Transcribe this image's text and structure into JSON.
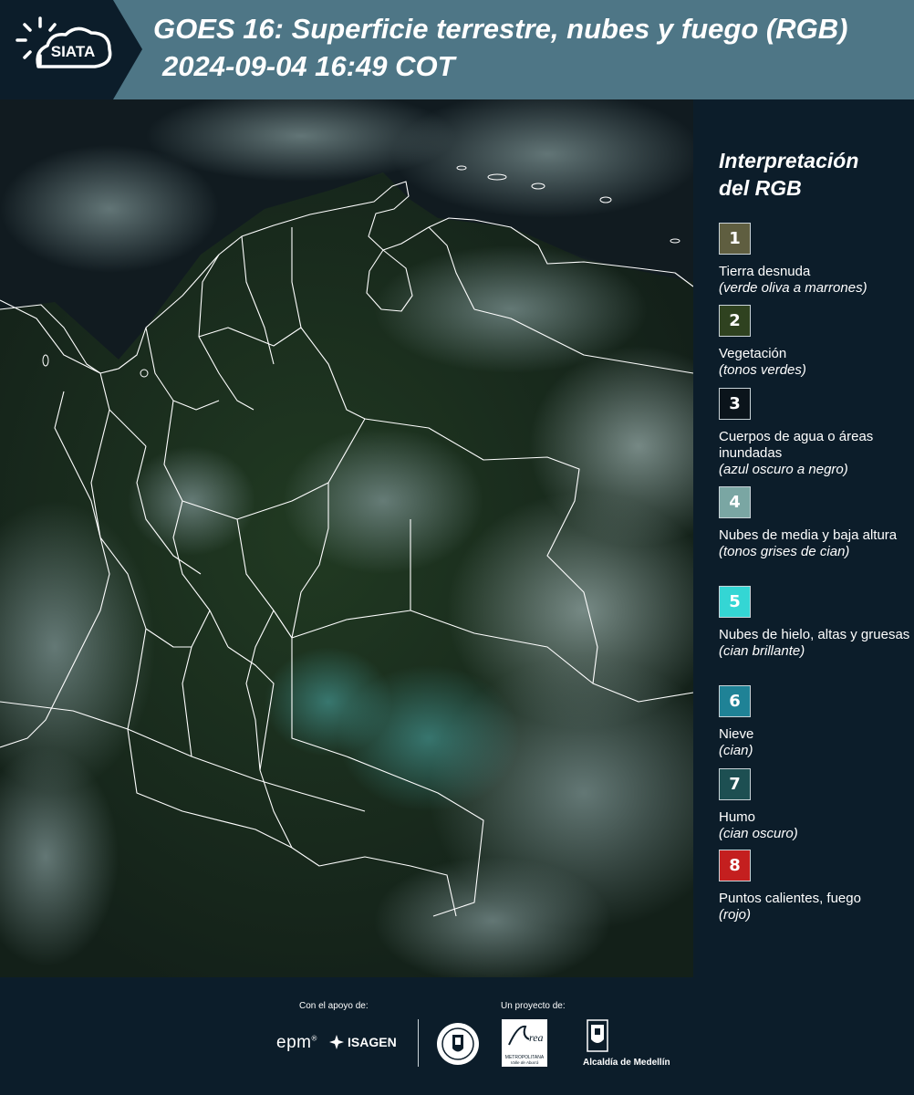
{
  "header": {
    "logo_text": "SIATA",
    "title": "GOES 16: Superficie terrestre, nubes y fuego (RGB)",
    "timestamp": "2024-09-04 16:49 COT"
  },
  "legend": {
    "title_line1": "Interpretación",
    "title_line2": "del RGB",
    "items": [
      {
        "num": "1",
        "color": "#5f5e40",
        "label": "Tierra desnuda",
        "note": "(verde oliva a marrones)"
      },
      {
        "num": "2",
        "color": "#2f4220",
        "label": "Vegetación",
        "note": "(tonos verdes)"
      },
      {
        "num": "3",
        "color": "#0b141b",
        "label": "Cuerpos de agua o áreas inundadas",
        "note": "(azul oscuro a negro)"
      },
      {
        "num": "4",
        "color": "#7aa6a3",
        "label": "Nubes de media y baja altura",
        "note": "(tonos grises de cian)"
      },
      {
        "num": "5",
        "color": "#34d6d4",
        "label": "Nubes de hielo, altas y gruesas",
        "note": "(cian brillante)"
      },
      {
        "num": "6",
        "color": "#1f8296",
        "label": "Nieve",
        "note": "(cian)"
      },
      {
        "num": "7",
        "color": "#1d4f52",
        "label": "Humo",
        "note": "(cian oscuro)"
      },
      {
        "num": "8",
        "color": "#c41f1f",
        "label": "Puntos calientes, fuego",
        "note": "(rojo)"
      }
    ]
  },
  "footer": {
    "support_label": "Con el apoyo de:",
    "project_label": "Un proyecto de:",
    "epm": "epm",
    "isagen": "ISAGEN",
    "area_name": "METROPOLITANA",
    "area_sub": "Valle de Aburrá",
    "alcaldia": "Alcaldía de Medellín"
  },
  "colors": {
    "header_bg": "#4e7686",
    "logo_bg": "#0c1d2a",
    "page_bg": "#0c1d2a",
    "borders": "#ffffff"
  }
}
